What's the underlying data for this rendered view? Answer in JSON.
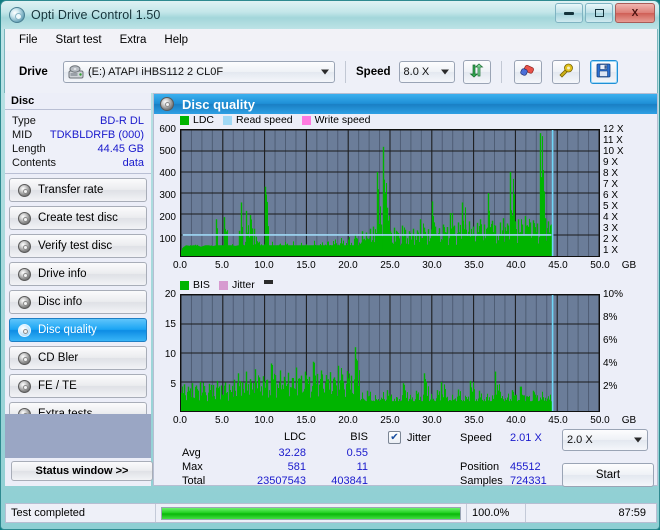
{
  "window": {
    "title": "Opti Drive Control 1.50",
    "app_icon": "disc-icon",
    "minimize": "–",
    "maximize": "□",
    "close": "X"
  },
  "menu": {
    "items": [
      "File",
      "Start test",
      "Extra",
      "Help"
    ]
  },
  "toolbar": {
    "drive_label": "Drive",
    "drive_value": "(E:)  ATAPI iHBS112  2 CL0F",
    "speed_label": "Speed",
    "speed_value": "8.0 X",
    "refresh_icon": "refresh-arrows-icon",
    "erase_icon": "eraser-icon",
    "tools_icon": "tools-icon",
    "save_icon": "save-disk-icon"
  },
  "disc": {
    "header": "Disc",
    "rows": [
      {
        "key": "Type",
        "value": "BD-R DL"
      },
      {
        "key": "MID",
        "value": "TDKBLDRFB (000)"
      },
      {
        "key": "Length",
        "value": "44.45 GB"
      },
      {
        "key": "Contents",
        "value": "data"
      }
    ]
  },
  "nav": {
    "items": [
      {
        "label": "Transfer rate",
        "active": false
      },
      {
        "label": "Create test disc",
        "active": false
      },
      {
        "label": "Verify test disc",
        "active": false
      },
      {
        "label": "Drive info",
        "active": false
      },
      {
        "label": "Disc info",
        "active": false
      },
      {
        "label": "Disc quality",
        "active": true
      },
      {
        "label": "CD Bler",
        "active": false
      },
      {
        "label": "FE / TE",
        "active": false
      },
      {
        "label": "Extra tests",
        "active": false
      }
    ],
    "status_window_button": "Status window >>"
  },
  "panel": {
    "title": "Disc quality",
    "title_icon": "disc-quality-icon"
  },
  "stats": {
    "col_headers": [
      "LDC",
      "BIS"
    ],
    "rows": [
      {
        "label": "Avg",
        "ldc": "32.28",
        "bis": "0.55"
      },
      {
        "label": "Max",
        "ldc": "581",
        "bis": "11"
      },
      {
        "label": "Total",
        "ldc": "23507543",
        "bis": "403841"
      }
    ],
    "jitter_checkbox_label": "Jitter",
    "jitter_checked": true,
    "speed_label": "Speed",
    "speed_value": "2.01 X",
    "position_label": "Position",
    "position_value": "45512",
    "samples_label": "Samples",
    "samples_value": "724331",
    "speed_select_value": "2.0 X",
    "start_button": "Start"
  },
  "statusbar": {
    "message": "Test completed",
    "percent": "100.0%",
    "progress_value": 100,
    "elapsed": "87:59"
  },
  "colors": {
    "ldc": "#00b400",
    "bis": "#00b400",
    "read_speed": "#9fd8f5",
    "write_speed": "#ff7ae0",
    "jitter": "#d79ad0",
    "plot_bg": "#6b7d99",
    "accent": "#1a8fd6",
    "value_text": "#1919cc"
  },
  "chart_data": [
    {
      "type": "line",
      "title": "Disc quality - LDC / Read speed",
      "legend": [
        {
          "label": "LDC",
          "color": "#00b400"
        },
        {
          "label": "Read speed",
          "color": "#9fd8f5"
        },
        {
          "label": "Write speed",
          "color": "#ff7ae0"
        }
      ],
      "legend_position": "top-left",
      "xlabel": "GB",
      "ylabel": "LDC",
      "y2label": "X",
      "xlim": [
        0,
        50
      ],
      "ylim": [
        0,
        600
      ],
      "y2lim": [
        0,
        12
      ],
      "xticks": [
        "0.0",
        "5.0",
        "10.0",
        "15.0",
        "20.0",
        "25.0",
        "30.0",
        "35.0",
        "40.0",
        "45.0",
        "50.0"
      ],
      "yticks": [
        100,
        200,
        300,
        400,
        500,
        600
      ],
      "y2ticks": [
        "1 X",
        "2 X",
        "3 X",
        "4 X",
        "5 X",
        "6 X",
        "7 X",
        "8 X",
        "9 X",
        "10 X",
        "11 X",
        "12 X"
      ],
      "grid": true,
      "data_end_gb": 44.45,
      "series": [
        {
          "name": "LDC",
          "color": "#00b400",
          "kind": "bars",
          "baseline_avg": 32.28,
          "max": 581,
          "x": [
            0.2,
            0.6,
            1.1,
            1.5,
            2.0,
            2.4,
            2.9,
            3.3,
            3.8,
            4.2,
            4.4,
            4.7,
            5.1,
            5.6,
            6.0,
            6.5,
            6.9,
            7.2,
            7.4,
            7.8,
            8.2,
            8.5,
            8.7,
            9.1,
            9.6,
            10.0,
            10.5,
            10.9,
            11.3,
            11.8,
            12.2,
            12.7,
            13.1,
            13.6,
            14.0,
            14.5,
            14.9,
            15.4,
            15.8,
            16.3,
            16.7,
            17.2,
            17.6,
            18.1,
            18.5,
            19.0,
            19.4,
            19.9,
            20.3,
            20.8,
            21.2,
            21.7,
            22.1,
            22.6,
            23.0,
            23.5,
            23.9,
            24.2,
            24.6,
            25.0,
            25.5,
            25.9,
            26.4,
            26.8,
            27.3,
            27.7,
            28.2,
            28.6,
            29.1,
            29.5,
            30.0,
            30.4,
            30.9,
            31.3,
            31.8,
            32.2,
            32.7,
            33.1,
            33.6,
            34.0,
            34.5,
            34.9,
            35.4,
            35.8,
            36.3,
            36.7,
            37.2,
            37.6,
            38.1,
            38.5,
            39.0,
            39.4,
            39.9,
            40.3,
            40.8,
            41.2,
            41.7,
            42.1,
            42.6,
            43.0,
            43.5,
            43.9,
            44.3
          ],
          "y": [
            40,
            55,
            48,
            62,
            50,
            44,
            58,
            52,
            47,
            175,
            60,
            55,
            185,
            52,
            60,
            48,
            120,
            255,
            70,
            215,
            195,
            60,
            130,
            75,
            65,
            330,
            70,
            60,
            68,
            62,
            75,
            60,
            70,
            64,
            66,
            70,
            62,
            68,
            74,
            66,
            72,
            78,
            70,
            86,
            80,
            90,
            84,
            96,
            92,
            105,
            100,
            118,
            112,
            130,
            140,
            400,
            150,
            520,
            230,
            120,
            135,
            110,
            145,
            125,
            118,
            130,
            122,
            175,
            135,
            128,
            260,
            140,
            132,
            150,
            138,
            205,
            145,
            160,
            255,
            150,
            165,
            140,
            158,
            175,
            150,
            300,
            168,
            145,
            160,
            180,
            155,
            400,
            165,
            175,
            150,
            190,
            160,
            170,
            155,
            585,
            180,
            165,
            150
          ]
        },
        {
          "name": "Read speed",
          "color": "#9fd8f5",
          "kind": "line",
          "axis": "right",
          "constant_x": 2.01,
          "x": [
            0.2,
            44.3
          ],
          "y": [
            2.01,
            2.01
          ]
        },
        {
          "name": "Write speed",
          "color": "#ff7ae0",
          "kind": "line",
          "axis": "right",
          "x": [],
          "y": []
        }
      ]
    },
    {
      "type": "bar",
      "title": "Disc quality - BIS / Jitter",
      "legend": [
        {
          "label": "BIS",
          "color": "#00b400"
        },
        {
          "label": "Jitter",
          "color": "#d79ad0"
        }
      ],
      "legend_position": "top-left",
      "xlabel": "GB",
      "ylabel": "BIS",
      "y2label": "%",
      "xlim": [
        0,
        50
      ],
      "ylim": [
        0,
        20
      ],
      "y2lim": [
        0,
        10
      ],
      "xticks": [
        "0.0",
        "5.0",
        "10.0",
        "15.0",
        "20.0",
        "25.0",
        "30.0",
        "35.0",
        "40.0",
        "45.0",
        "50.0"
      ],
      "yticks": [
        5,
        10,
        15,
        20
      ],
      "y2ticks": [
        "2%",
        "4%",
        "6%",
        "8%",
        "10%"
      ],
      "grid": true,
      "data_end_gb": 44.45,
      "series": [
        {
          "name": "BIS",
          "color": "#00b400",
          "kind": "bars",
          "avg": 0.55,
          "max": 11,
          "x": [
            0.3,
            0.8,
            1.3,
            1.8,
            2.3,
            2.8,
            3.3,
            3.8,
            4.3,
            4.8,
            5.3,
            5.8,
            6.3,
            6.8,
            7.3,
            7.8,
            8.3,
            8.8,
            9.3,
            9.8,
            10.3,
            10.8,
            11.3,
            11.8,
            12.3,
            12.8,
            13.3,
            13.8,
            14.3,
            14.8,
            15.3,
            15.8,
            16.3,
            16.8,
            17.3,
            17.8,
            18.3,
            18.8,
            19.3,
            19.8,
            20.3,
            20.8,
            21.3,
            21.8,
            22.3,
            22.8,
            23.3,
            23.8,
            24.2,
            24.6,
            25.1,
            25.6,
            26.1,
            26.6,
            27.1,
            27.6,
            28.1,
            28.6,
            29.1,
            29.6,
            30.1,
            30.6,
            31.1,
            31.6,
            32.1,
            32.6,
            33.1,
            33.6,
            34.1,
            34.6,
            35.1,
            35.6,
            36.1,
            36.6,
            37.1,
            37.6,
            38.1,
            38.6,
            39.1,
            39.6,
            40.1,
            40.6,
            41.1,
            41.6,
            42.1,
            42.6,
            43.1,
            43.6,
            44.1
          ],
          "y": [
            4.6,
            4.2,
            4.8,
            4.4,
            5.0,
            4.3,
            4.7,
            4.5,
            5.2,
            4.4,
            4.9,
            4.6,
            5.4,
            6.5,
            5.0,
            6.8,
            5.5,
            7.2,
            5.8,
            6.0,
            5.4,
            8.2,
            6.2,
            7.0,
            5.9,
            6.6,
            5.7,
            7.5,
            6.1,
            6.8,
            5.9,
            8.5,
            6.4,
            7.0,
            6.2,
            6.7,
            5.8,
            7.8,
            6.3,
            6.9,
            6.1,
            11.0,
            3.2,
            2.8,
            3.5,
            3.0,
            2.6,
            3.3,
            2.9,
            3.6,
            3.1,
            2.7,
            3.4,
            4.8,
            3.0,
            2.8,
            3.5,
            3.2,
            6.5,
            3.0,
            2.9,
            3.6,
            5.0,
            3.1,
            2.8,
            3.3,
            3.7,
            2.9,
            3.2,
            5.2,
            3.0,
            3.5,
            2.8,
            3.3,
            3.1,
            6.8,
            3.4,
            2.9,
            3.2,
            3.6,
            3.0,
            4.2,
            3.3,
            2.8,
            3.5,
            3.1,
            3.4,
            2.9,
            3.2
          ]
        },
        {
          "name": "Jitter",
          "color": "#d79ad0",
          "kind": "line",
          "axis": "right",
          "x": [],
          "y": []
        }
      ]
    }
  ]
}
